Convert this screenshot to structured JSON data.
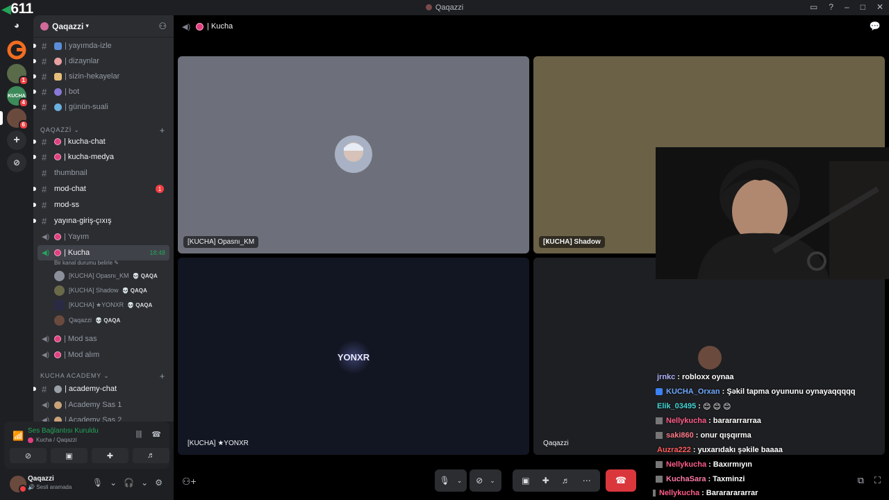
{
  "window": {
    "title": "Qaqazzi",
    "viewer_count": "611"
  },
  "sidebar": {
    "server_name": "Qaqazzi",
    "channels_top": [
      {
        "label": "| yayımda-izle",
        "type": "text"
      },
      {
        "label": "| dizaynlar",
        "type": "text"
      },
      {
        "label": "| sizin-hekayelar",
        "type": "text"
      },
      {
        "label": "| bot",
        "type": "text"
      },
      {
        "label": "| günün-suali",
        "type": "text"
      }
    ],
    "category_1": "QAQAZZİ",
    "channels_qaqazzi": [
      {
        "label": "| kucha-chat"
      },
      {
        "label": "| kucha-medya"
      },
      {
        "label": "thumbnail"
      },
      {
        "label": "mod-chat",
        "badge": "1"
      },
      {
        "label": "mod-ss"
      },
      {
        "label": "yayına-giriş-çıxış"
      }
    ],
    "voice_yayim": "| Yayım",
    "voice_active": {
      "label": "| Kucha",
      "timer": "18:48",
      "status_text": "Bir kanal durumu belirle"
    },
    "voice_users": [
      {
        "name": "[KUCHA] Opasnı_KM",
        "tag": "QAQA"
      },
      {
        "name": "[KUCHA] Shadow",
        "tag": "QAQA"
      },
      {
        "name": "[KUCHA] ★YONXR",
        "tag": "QAQA"
      },
      {
        "name": "Qaqazzi",
        "tag": "QAQA"
      }
    ],
    "voice_more": [
      "| Mod sas",
      "| Mod alım"
    ],
    "category_2": "KUCHA ACADEMY",
    "channels_academy": [
      {
        "label": "| academy-chat"
      },
      {
        "label": "| Academy Sas 1"
      },
      {
        "label": "| Academy Sas 2"
      }
    ]
  },
  "voice_panel": {
    "status": "Ses Bağlantısı Kuruldu",
    "location": "Kucha / Qaqazzi"
  },
  "user_panel": {
    "username": "Qaqazzi",
    "status": "Sesli aramada"
  },
  "main": {
    "channel_title": "| Kucha",
    "tiles": [
      {
        "name": "[KUCHA] Opasnı_KM"
      },
      {
        "name": "[ҜUCHA] Shadow"
      },
      {
        "name": "[KUCHA] ★YONXR",
        "logo": "YONXR"
      },
      {
        "name": "Qaqazzi"
      }
    ]
  },
  "chat_overlay": [
    {
      "user": "jrnkc",
      "text": "robloxx oynaa",
      "color": "#b3b3ff"
    },
    {
      "user": "KUCHA_Orxan",
      "text": "Şəkil tapma oyununu oynayaqqqqq",
      "color": "#6fa8ff"
    },
    {
      "user": "Elik_03495",
      "text": "😊 😊 😊",
      "color": "#44d6d6"
    },
    {
      "user": "Nellykucha",
      "text": "barararrarraa",
      "color": "#ff5c8a"
    },
    {
      "user": "saki860",
      "text": "onur qışqırma",
      "color": "#ff7a8a"
    },
    {
      "user": "Auzra222",
      "text": "yuxarıdakı şəkile baaaa",
      "color": "#ff5c5c"
    },
    {
      "user": "Nellykucha",
      "text": "Baxırmıyın",
      "color": "#ff5c8a"
    },
    {
      "user": "KuchaSara",
      "text": "Taxminzi",
      "color": "#ff7aa8"
    },
    {
      "user": "Nellykucha",
      "text": "Barararararrar",
      "color": "#ff5c8a"
    }
  ],
  "colors": {
    "accent_green": "#23a55a",
    "danger": "#da373c",
    "pink_dot": "#e23e80"
  }
}
